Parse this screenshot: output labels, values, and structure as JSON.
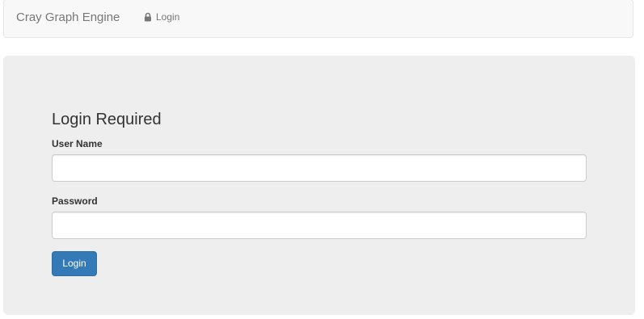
{
  "navbar": {
    "brand": "Cray Graph Engine",
    "login_link": {
      "icon": "lock-icon",
      "label": "Login"
    }
  },
  "form": {
    "title": "Login Required",
    "username": {
      "label": "User Name",
      "value": "",
      "placeholder": ""
    },
    "password": {
      "label": "Password",
      "value": "",
      "placeholder": ""
    },
    "submit_label": "Login"
  },
  "colors": {
    "navbar_bg": "#f8f8f8",
    "jumbotron_bg": "#eeeeee",
    "primary_button": "#337ab7"
  }
}
